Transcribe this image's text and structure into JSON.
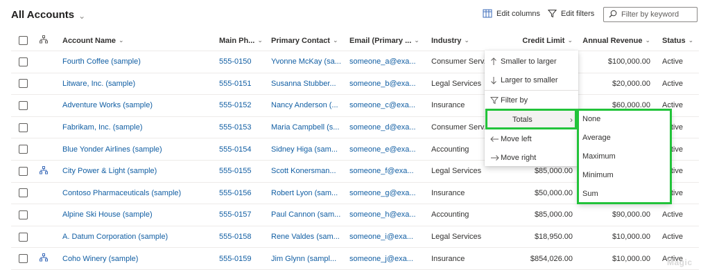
{
  "header": {
    "title": "All Accounts",
    "edit_columns": "Edit columns",
    "edit_filters": "Edit filters",
    "search_placeholder": "Filter by keyword"
  },
  "columns": {
    "account_name": "Account Name",
    "main_phone": "Main Ph...",
    "primary_contact": "Primary Contact",
    "email": "Email (Primary ...",
    "industry": "Industry",
    "credit_limit": "Credit Limit",
    "annual_revenue": "Annual Revenue",
    "status": "Status"
  },
  "rows": [
    {
      "name": "Fourth Coffee (sample)",
      "phone": "555-0150",
      "contact": "Yvonne McKay (sa...",
      "email": "someone_a@exa...",
      "industry": "Consumer Serv...",
      "credit": "",
      "revenue": "$100,000.00",
      "status": "Active",
      "hier": false
    },
    {
      "name": "Litware, Inc. (sample)",
      "phone": "555-0151",
      "contact": "Susanna Stubber...",
      "email": "someone_b@exa...",
      "industry": "Legal Services",
      "credit": "",
      "revenue": "$20,000.00",
      "status": "Active",
      "hier": false
    },
    {
      "name": "Adventure Works (sample)",
      "phone": "555-0152",
      "contact": "Nancy Anderson (...",
      "email": "someone_c@exa...",
      "industry": "Insurance",
      "credit": "",
      "revenue": "$60,000.00",
      "status": "Active",
      "hier": false
    },
    {
      "name": "Fabrikam, Inc. (sample)",
      "phone": "555-0153",
      "contact": "Maria Campbell (s...",
      "email": "someone_d@exa...",
      "industry": "Consumer Serv...",
      "credit": "",
      "revenue": "",
      "status": "Active",
      "hier": false
    },
    {
      "name": "Blue Yonder Airlines (sample)",
      "phone": "555-0154",
      "contact": "Sidney Higa (sam...",
      "email": "someone_e@exa...",
      "industry": "Accounting",
      "credit": "",
      "revenue": "",
      "status": "Active",
      "hier": false
    },
    {
      "name": "City Power & Light (sample)",
      "phone": "555-0155",
      "contact": "Scott Konersman...",
      "email": "someone_f@exa...",
      "industry": "Legal Services",
      "credit": "$85,000.00",
      "revenue": "",
      "status": "Active",
      "hier": true
    },
    {
      "name": "Contoso Pharmaceuticals (sample)",
      "phone": "555-0156",
      "contact": "Robert Lyon (sam...",
      "email": "someone_g@exa...",
      "industry": "Insurance",
      "credit": "$50,000.00",
      "revenue": "",
      "status": "Active",
      "hier": false
    },
    {
      "name": "Alpine Ski House (sample)",
      "phone": "555-0157",
      "contact": "Paul Cannon (sam...",
      "email": "someone_h@exa...",
      "industry": "Accounting",
      "credit": "$85,000.00",
      "revenue": "$90,000.00",
      "status": "Active",
      "hier": false
    },
    {
      "name": "A. Datum Corporation (sample)",
      "phone": "555-0158",
      "contact": "Rene Valdes (sam...",
      "email": "someone_i@exa...",
      "industry": "Legal Services",
      "credit": "$18,950.00",
      "revenue": "$10,000.00",
      "status": "Active",
      "hier": false
    },
    {
      "name": "Coho Winery (sample)",
      "phone": "555-0159",
      "contact": "Jim Glynn (sampl...",
      "email": "someone_j@exa...",
      "industry": "Insurance",
      "credit": "$854,026.00",
      "revenue": "$10,000.00",
      "status": "Active",
      "hier": true
    }
  ],
  "column_menu": {
    "smaller_to_larger": "Smaller to larger",
    "larger_to_smaller": "Larger to smaller",
    "filter_by": "Filter by",
    "totals": "Totals",
    "move_left": "Move left",
    "move_right": "Move right"
  },
  "totals_menu": [
    "None",
    "Average",
    "Maximum",
    "Minimum",
    "Sum"
  ],
  "watermark": "Magic",
  "colors": {
    "link": "#115ea3",
    "highlight": "#22c33a"
  }
}
